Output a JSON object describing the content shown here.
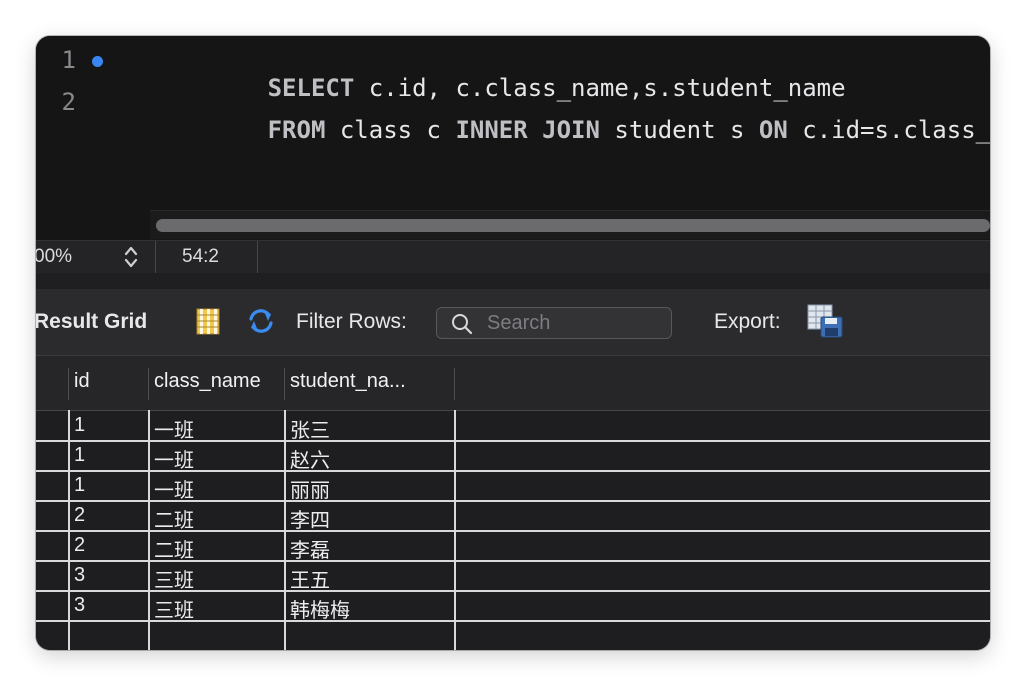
{
  "editor": {
    "lines": [
      {
        "number": "1",
        "tokens": [
          {
            "t": "SELECT",
            "kw": true
          },
          {
            "t": " c.id, c.class_name,s.student_name",
            "kw": false
          }
        ]
      },
      {
        "number": "2",
        "tokens": [
          {
            "t": "FROM",
            "kw": true
          },
          {
            "t": " class c ",
            "kw": false
          },
          {
            "t": "INNER JOIN",
            "kw": true
          },
          {
            "t": " student s ",
            "kw": false
          },
          {
            "t": "ON",
            "kw": true
          },
          {
            "t": " c.id=s.class_id",
            "kw": false
          }
        ]
      }
    ]
  },
  "status": {
    "zoom": "00%",
    "cursor": "54:2"
  },
  "toolbar": {
    "result_tab": "Result Grid",
    "filter_label": "Filter Rows:",
    "search_placeholder": "Search",
    "export_label": "Export:"
  },
  "grid": {
    "columns": [
      "id",
      "class_name",
      "student_na..."
    ],
    "rows": [
      [
        "1",
        "一班",
        "张三"
      ],
      [
        "1",
        "一班",
        "赵六"
      ],
      [
        "1",
        "一班",
        "丽丽"
      ],
      [
        "2",
        "二班",
        "李四"
      ],
      [
        "2",
        "二班",
        "李磊"
      ],
      [
        "3",
        "三班",
        "王五"
      ],
      [
        "3",
        "三班",
        "韩梅梅"
      ]
    ]
  },
  "colors": {
    "breakpoint": "#3a86f0",
    "keyword": "#bfbfc4",
    "refresh_icon": "#3b8cf0",
    "grid_lines": "#d9d9dc"
  }
}
